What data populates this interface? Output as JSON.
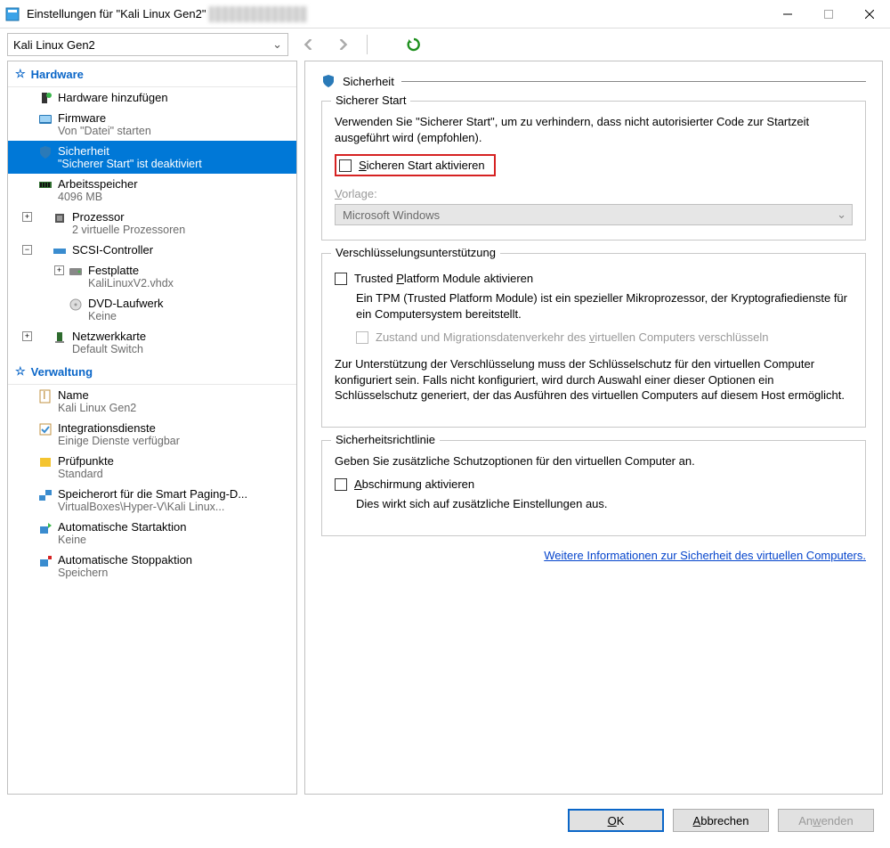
{
  "window": {
    "title": "Einstellungen für \"Kali Linux Gen2\""
  },
  "vm_selector": {
    "value": "Kali Linux Gen2"
  },
  "tree": {
    "hardware_header": "Hardware",
    "items": [
      {
        "label": "Hardware hinzufügen",
        "sub": ""
      },
      {
        "label": "Firmware",
        "sub": "Von \"Datei\" starten"
      },
      {
        "label": "Sicherheit",
        "sub": "\"Sicherer Start\" ist deaktiviert"
      },
      {
        "label": "Arbeitsspeicher",
        "sub": "4096 MB"
      },
      {
        "label": "Prozessor",
        "sub": "2 virtuelle Prozessoren"
      },
      {
        "label": "SCSI-Controller",
        "sub": ""
      },
      {
        "label": "Festplatte",
        "sub": "KaliLinuxV2.vhdx"
      },
      {
        "label": "DVD-Laufwerk",
        "sub": "Keine"
      },
      {
        "label": "Netzwerkkarte",
        "sub": "Default Switch"
      }
    ],
    "management_header": "Verwaltung",
    "mgmt": [
      {
        "label": "Name",
        "sub": "Kali Linux Gen2"
      },
      {
        "label": "Integrationsdienste",
        "sub": "Einige Dienste verfügbar"
      },
      {
        "label": "Prüfpunkte",
        "sub": "Standard"
      },
      {
        "label": "Speicherort für die Smart Paging-D...",
        "sub": "VirtualBoxes\\Hyper-V\\Kali Linux..."
      },
      {
        "label": "Automatische Startaktion",
        "sub": "Keine"
      },
      {
        "label": "Automatische Stoppaktion",
        "sub": "Speichern"
      }
    ]
  },
  "panel": {
    "title": "Sicherheit",
    "secure_boot": {
      "legend": "Sicherer Start",
      "desc": "Verwenden Sie \"Sicherer Start\", um zu verhindern, dass nicht autorisierter Code zur Startzeit ausgeführt wird (empfohlen).",
      "checkbox_label": "Sicheren Start aktivieren",
      "template_label": "Vorlage:",
      "template_value": "Microsoft Windows"
    },
    "encryption": {
      "legend": "Verschlüsselungsunterstützung",
      "tpm_label": "Trusted Platform Module aktivieren",
      "tpm_desc": "Ein TPM (Trusted Platform Module) ist ein spezieller Mikroprozessor, der Kryptografiedienste für ein Computersystem bereitstellt.",
      "migrate_label": "Zustand und Migrationsdatenverkehr des virtuellen Computers verschlüsseln",
      "note": "Zur Unterstützung der Verschlüsselung muss der Schlüsselschutz für den virtuellen Computer konfiguriert sein. Falls nicht konfiguriert, wird durch Auswahl einer dieser Optionen ein Schlüsselschutz generiert, der das Ausführen des virtuellen Computers auf diesem Host ermöglicht."
    },
    "policy": {
      "legend": "Sicherheitsrichtlinie",
      "desc": "Geben Sie zusätzliche Schutzoptionen für den virtuellen Computer an.",
      "shield_label": "Abschirmung aktivieren",
      "shield_note": "Dies wirkt sich auf zusätzliche Einstellungen aus."
    },
    "link": "Weitere Informationen zur Sicherheit des virtuellen Computers."
  },
  "buttons": {
    "ok": "OK",
    "cancel": "Abbrechen",
    "apply": "Anwenden"
  }
}
